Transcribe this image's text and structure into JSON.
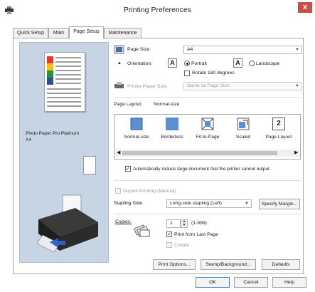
{
  "window": {
    "title": "Printing Preferences",
    "close_label": "x"
  },
  "tabs": [
    "Quick Setup",
    "Main",
    "Page Setup",
    "Maintenance"
  ],
  "preview": {
    "paper_name": "Photo Paper Pro Platinum",
    "paper_size": "A4"
  },
  "page_setup": {
    "page_size_label": "Page Size:",
    "page_size_value": "A4",
    "orientation_label": "Orientation:",
    "portrait_label": "Portrait",
    "landscape_label": "Landscape",
    "rotate_label": "Rotate 180 degrees",
    "printer_paper_size_label": "Printer Paper Size:",
    "printer_paper_size_value": "Same as Page Size"
  },
  "page_layout": {
    "label": "Page Layout:",
    "current": "Normal-size",
    "items": [
      "Normal-size",
      "Borderless",
      "Fit-to-Page",
      "Scaled",
      "Page Layout"
    ],
    "page_layout_num": "2",
    "auto_reduce_label": "Automatically reduce large document that the printer cannot output"
  },
  "duplex": {
    "label": "Duplex Printing (Manual)",
    "stapling_label": "Stapling Side:",
    "stapling_value": "Long-side stapling (Left)",
    "specify_margin_label": "Specify Margin..."
  },
  "copies": {
    "label": "Copies:",
    "value": "1",
    "range": "(1-999)",
    "print_last_label": "Print from Last Page",
    "collate_label": "Collate"
  },
  "buttons": {
    "print_options": "Print Options...",
    "stamp_background": "Stamp/Background...",
    "defaults": "Defaults",
    "ok": "OK",
    "cancel": "Cancel",
    "help": "Help"
  }
}
